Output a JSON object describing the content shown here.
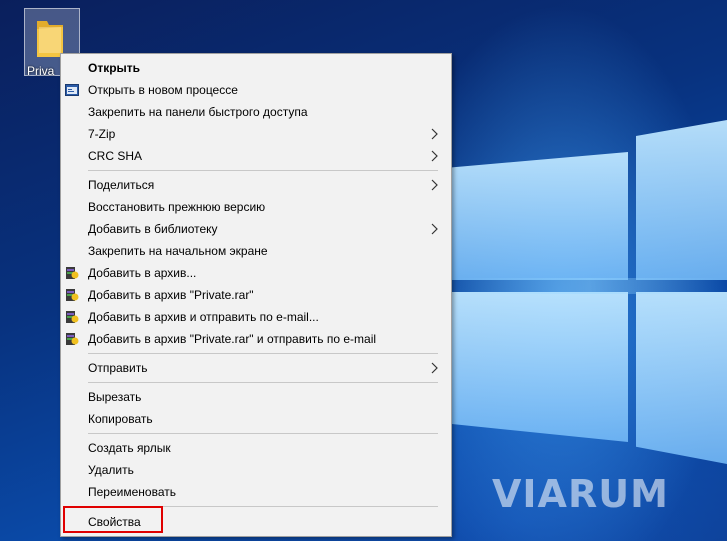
{
  "desktop": {
    "watermark": "VIARUM",
    "icon_label": "Priva"
  },
  "menu": {
    "items": [
      {
        "label": "Открыть"
      },
      {
        "label": "Открыть в новом процессе"
      },
      {
        "label": "Закрепить на панели быстрого доступа"
      },
      {
        "label": "7-Zip"
      },
      {
        "label": "CRC SHA"
      },
      {
        "label": "Поделиться"
      },
      {
        "label": "Восстановить прежнюю версию"
      },
      {
        "label": "Добавить в библиотеку"
      },
      {
        "label": "Закрепить на начальном экране"
      },
      {
        "label": "Добавить в архив..."
      },
      {
        "label": "Добавить в архив \"Private.rar\""
      },
      {
        "label": "Добавить в архив и отправить по e-mail..."
      },
      {
        "label": "Добавить в архив \"Private.rar\" и отправить по e-mail"
      },
      {
        "label": "Отправить"
      },
      {
        "label": "Вырезать"
      },
      {
        "label": "Копировать"
      },
      {
        "label": "Создать ярлык"
      },
      {
        "label": "Удалить"
      },
      {
        "label": "Переименовать"
      },
      {
        "label": "Свойства"
      }
    ]
  },
  "colors": {
    "menu_bg": "#f2f2f2",
    "highlight": "#e00000",
    "folder": "#f4c542"
  }
}
